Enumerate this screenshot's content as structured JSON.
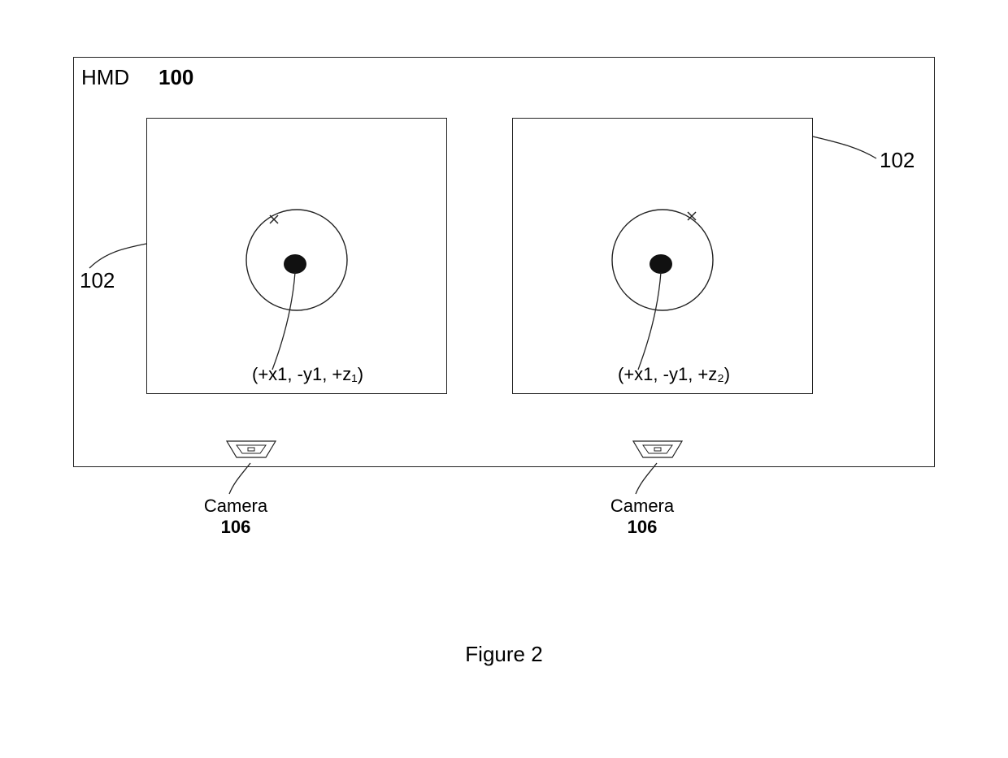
{
  "hmd_label": "HMD",
  "hmd_ref": "100",
  "display_ref": "102",
  "coords_left": "(+x1, -y1, +z₁)",
  "coords_right": "(+x1, -y1, +z₂)",
  "camera_label": "Camera",
  "camera_ref": "106",
  "figure_caption": "Figure 2"
}
